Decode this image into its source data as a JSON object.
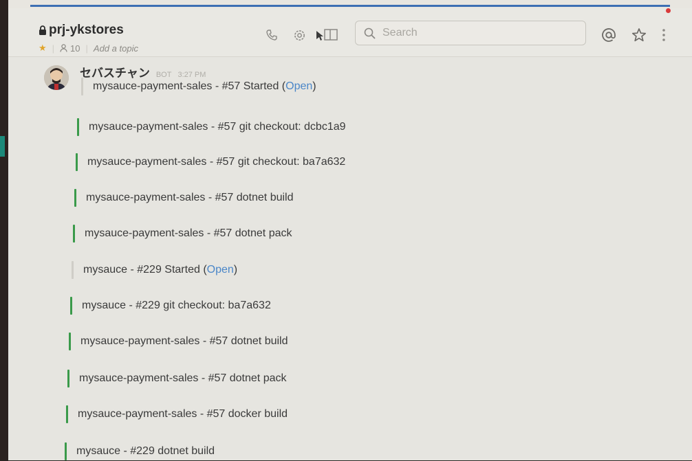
{
  "header": {
    "channel_name": "prj-ykstores",
    "member_count": "10",
    "add_topic": "Add a topic",
    "search_placeholder": "Search"
  },
  "message": {
    "sender": "セバスチャン",
    "badge": "BOT",
    "time": "3:27 PM",
    "attachments": [
      {
        "text": "mysauce-payment-sales - #57 Started (",
        "link": "Open",
        "suffix": ")",
        "color": "grey"
      },
      {
        "text": "mysauce-payment-sales - #57 git checkout: dcbc1a9",
        "color": "green"
      },
      {
        "text": "mysauce-payment-sales - #57 git checkout: ba7a632",
        "color": "green"
      },
      {
        "text": "mysauce-payment-sales - #57 dotnet build",
        "color": "green"
      },
      {
        "text": "mysauce-payment-sales - #57 dotnet pack",
        "color": "green"
      },
      {
        "text": "mysauce - #229 Started (",
        "link": "Open",
        "suffix": ")",
        "color": "grey"
      },
      {
        "text": "mysauce - #229 git checkout: ba7a632",
        "color": "green"
      },
      {
        "text": "mysauce-payment-sales - #57 dotnet build",
        "color": "green"
      },
      {
        "text": "mysauce-payment-sales - #57 dotnet pack",
        "color": "green"
      },
      {
        "text": "mysauce-payment-sales - #57 docker build",
        "color": "green"
      },
      {
        "text": "mysauce - #229 dotnet build",
        "color": "green"
      }
    ]
  },
  "colors": {
    "accent_green": "#3a9a4a",
    "link_blue": "#4a86c8",
    "star": "#e0a42a",
    "notification": "#d93a3a"
  }
}
